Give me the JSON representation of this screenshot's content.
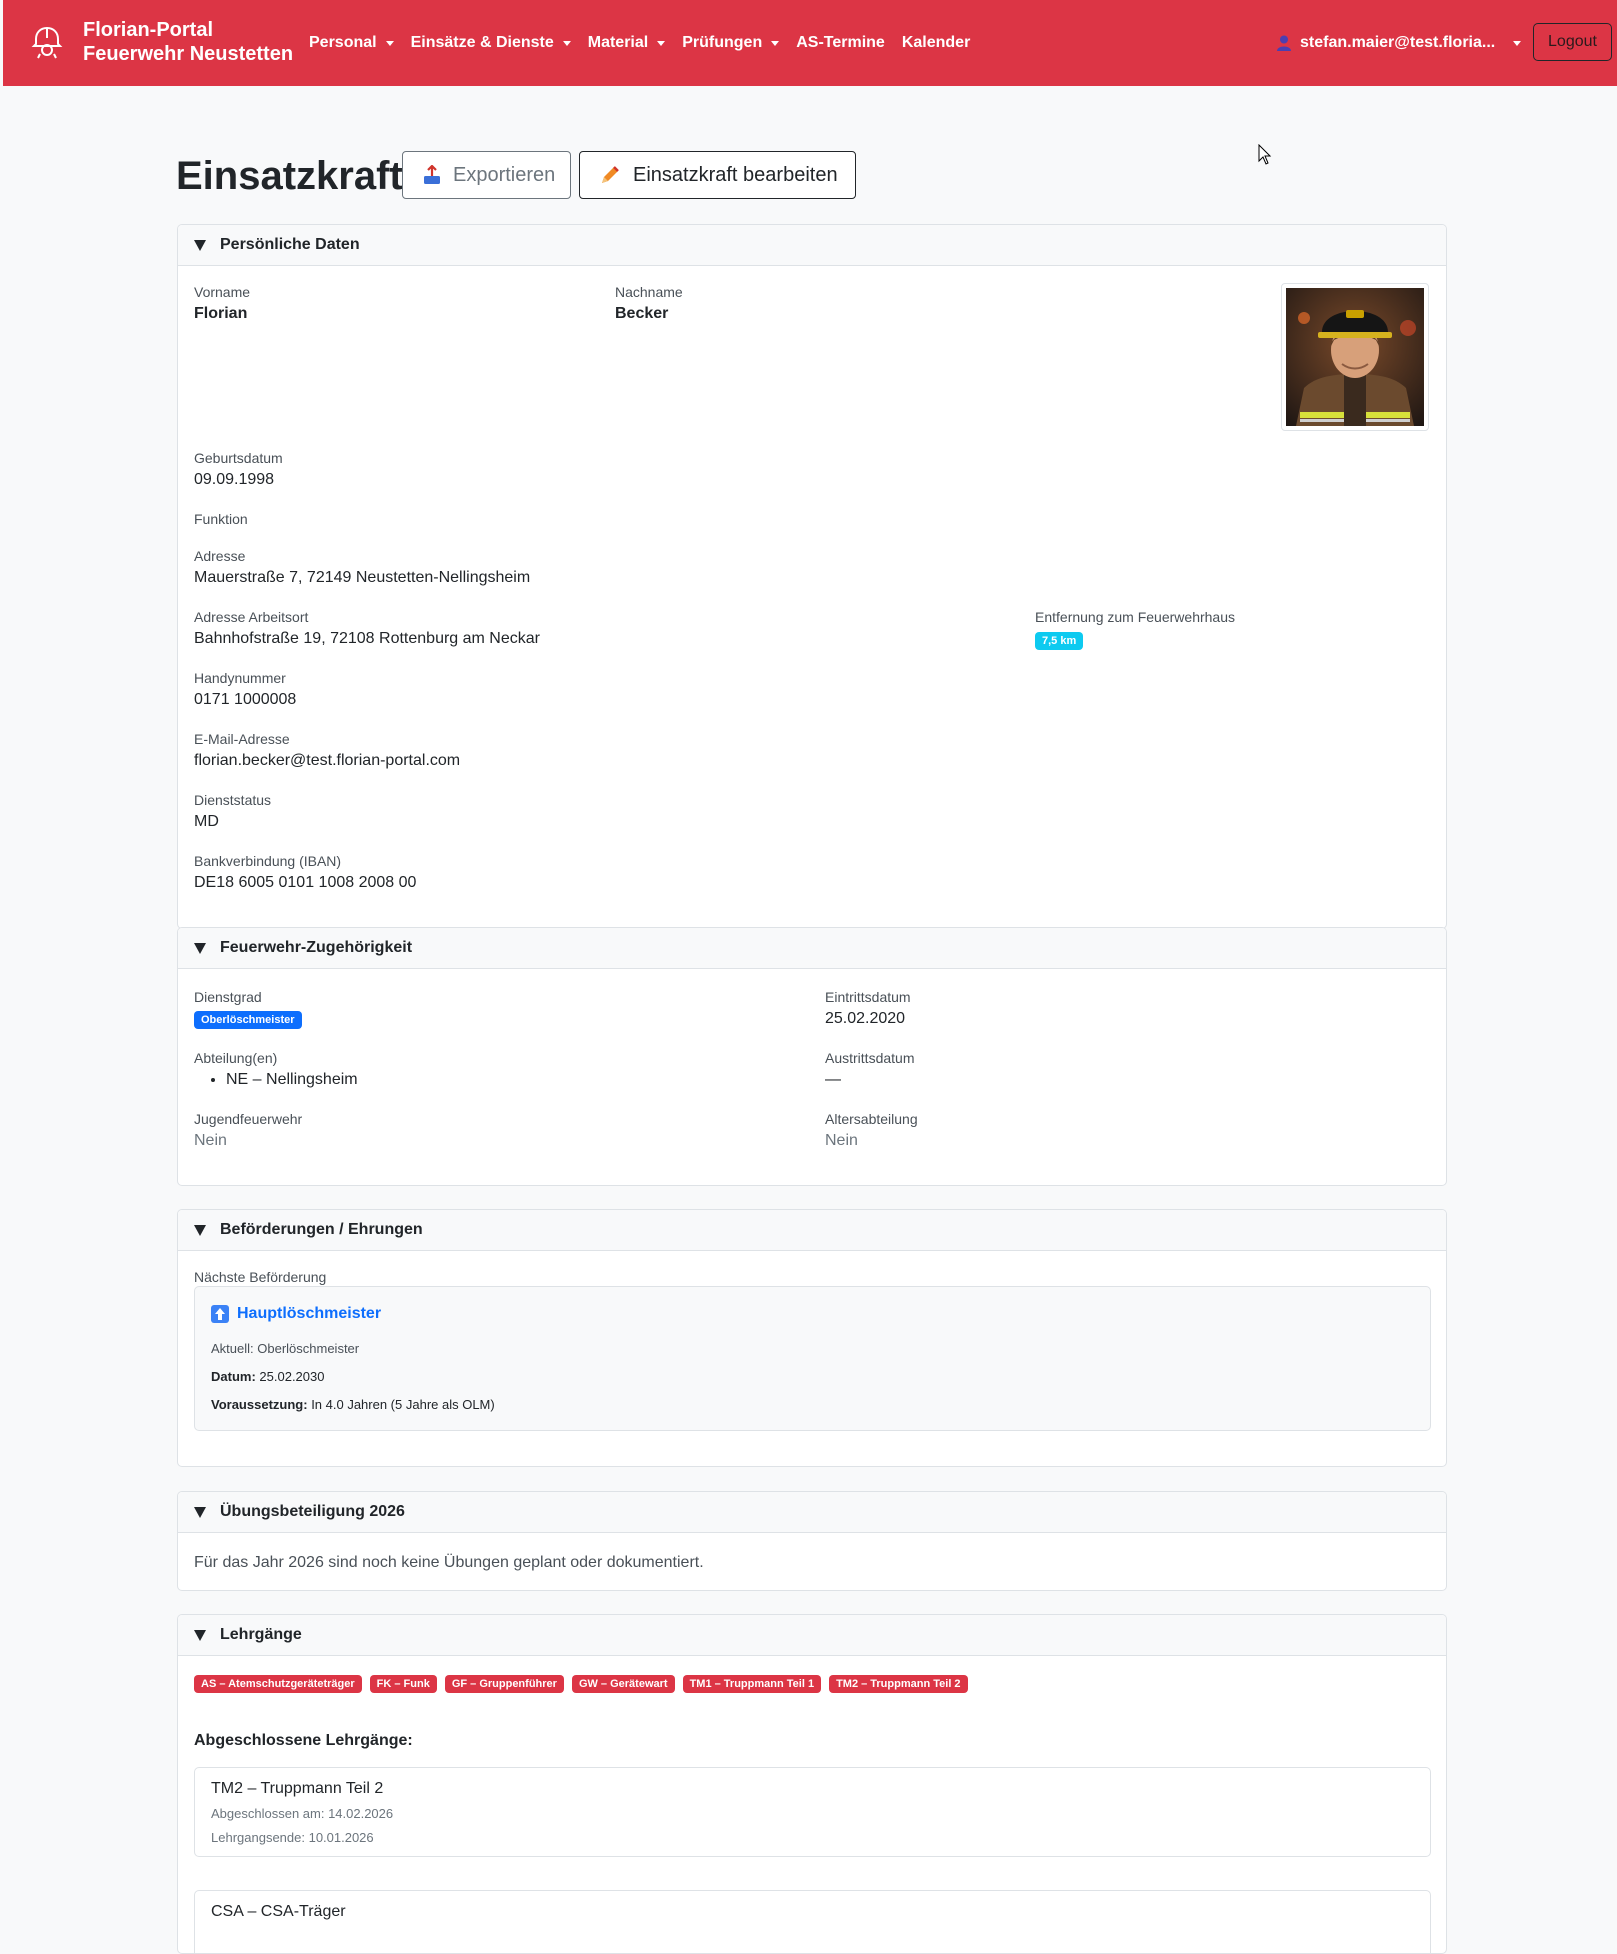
{
  "nav": {
    "brand_line1": "Florian-Portal",
    "brand_line2": "Feuerwehr Neustetten",
    "items": [
      {
        "label": "Personal",
        "dropdown": true
      },
      {
        "label": "Einsätze & Dienste",
        "dropdown": true
      },
      {
        "label": "Material",
        "dropdown": true
      },
      {
        "label": "Prüfungen",
        "dropdown": true
      },
      {
        "label": "AS-Termine",
        "dropdown": false
      },
      {
        "label": "Kalender",
        "dropdown": false
      }
    ],
    "user": "stefan.maier@test.floria...",
    "logout": "Logout",
    "color": "#dc3545"
  },
  "page": {
    "title": "Einsatzkraft",
    "export_label": "Exportieren",
    "edit_label": "Einsatzkraft bearbeiten"
  },
  "personal": {
    "header": "Persönliche Daten",
    "vorname_label": "Vorname",
    "vorname": "Florian",
    "nachname_label": "Nachname",
    "nachname": "Becker",
    "geburtsdatum_label": "Geburtsdatum",
    "geburtsdatum": "09.09.1998",
    "funktion_label": "Funktion",
    "adresse_label": "Adresse",
    "adresse": "Mauerstraße 7, 72149 Neustetten-Nellingsheim",
    "arbeitsort_label": "Adresse Arbeitsort",
    "arbeitsort": "Bahnhofstraße 19, 72108 Rottenburg am Neckar",
    "entfernung_label": "Entfernung zum Feuerwehrhaus",
    "entfernung": "7,5 km",
    "handy_label": "Handynummer",
    "handy": "0171 1000008",
    "email_label": "E-Mail-Adresse",
    "email": "florian.becker@test.florian-portal.com",
    "dienststatus_label": "Dienststatus",
    "dienststatus": "MD",
    "iban_label": "Bankverbindung (IBAN)",
    "iban": "DE18 6005 0101 1008 2008 00"
  },
  "zugehoerigkeit": {
    "header": "Feuerwehr-Zugehörigkeit",
    "dienstgrad_label": "Dienstgrad",
    "dienstgrad": "Oberlöschmeister",
    "eintritt_label": "Eintrittsdatum",
    "eintritt": "25.02.2020",
    "abteilung_label": "Abteilung(en)",
    "abteilungen": [
      "NE – Nellingsheim"
    ],
    "austritt_label": "Austrittsdatum",
    "austritt": "—",
    "jugend_label": "Jugendfeuerwehr",
    "jugend": "Nein",
    "alters_label": "Altersabteilung",
    "alters": "Nein"
  },
  "befoerderung": {
    "header": "Beförderungen / Ehrungen",
    "naechste_label": "Nächste Beförderung",
    "rang": "Hauptlöschmeister",
    "aktuell": "Aktuell: Oberlöschmeister",
    "datum_label": "Datum:",
    "datum": "25.02.2030",
    "voraussetzung_label": "Voraussetzung:",
    "voraussetzung": "In 4.0 Jahren (5 Jahre als OLM)"
  },
  "uebung": {
    "header": "Übungsbeteiligung 2026",
    "text": "Für das Jahr 2026 sind noch keine Übungen geplant oder dokumentiert."
  },
  "lehrgaenge": {
    "header": "Lehrgänge",
    "badges": [
      "AS – Atemschutzgeräteträger",
      "FK – Funk",
      "GF – Gruppenführer",
      "GW – Gerätewart",
      "TM1 – Truppmann Teil 1",
      "TM2 – Truppmann Teil 2"
    ],
    "abgeschlossen_label": "Abgeschlossene Lehrgänge:",
    "items": [
      {
        "name": "TM2 – Truppmann Teil 2",
        "abgeschlossen": "Abgeschlossen am: 14.02.2026",
        "ende": "Lehrgangsende: 10.01.2026"
      },
      {
        "name": "CSA – CSA-Träger"
      }
    ]
  }
}
